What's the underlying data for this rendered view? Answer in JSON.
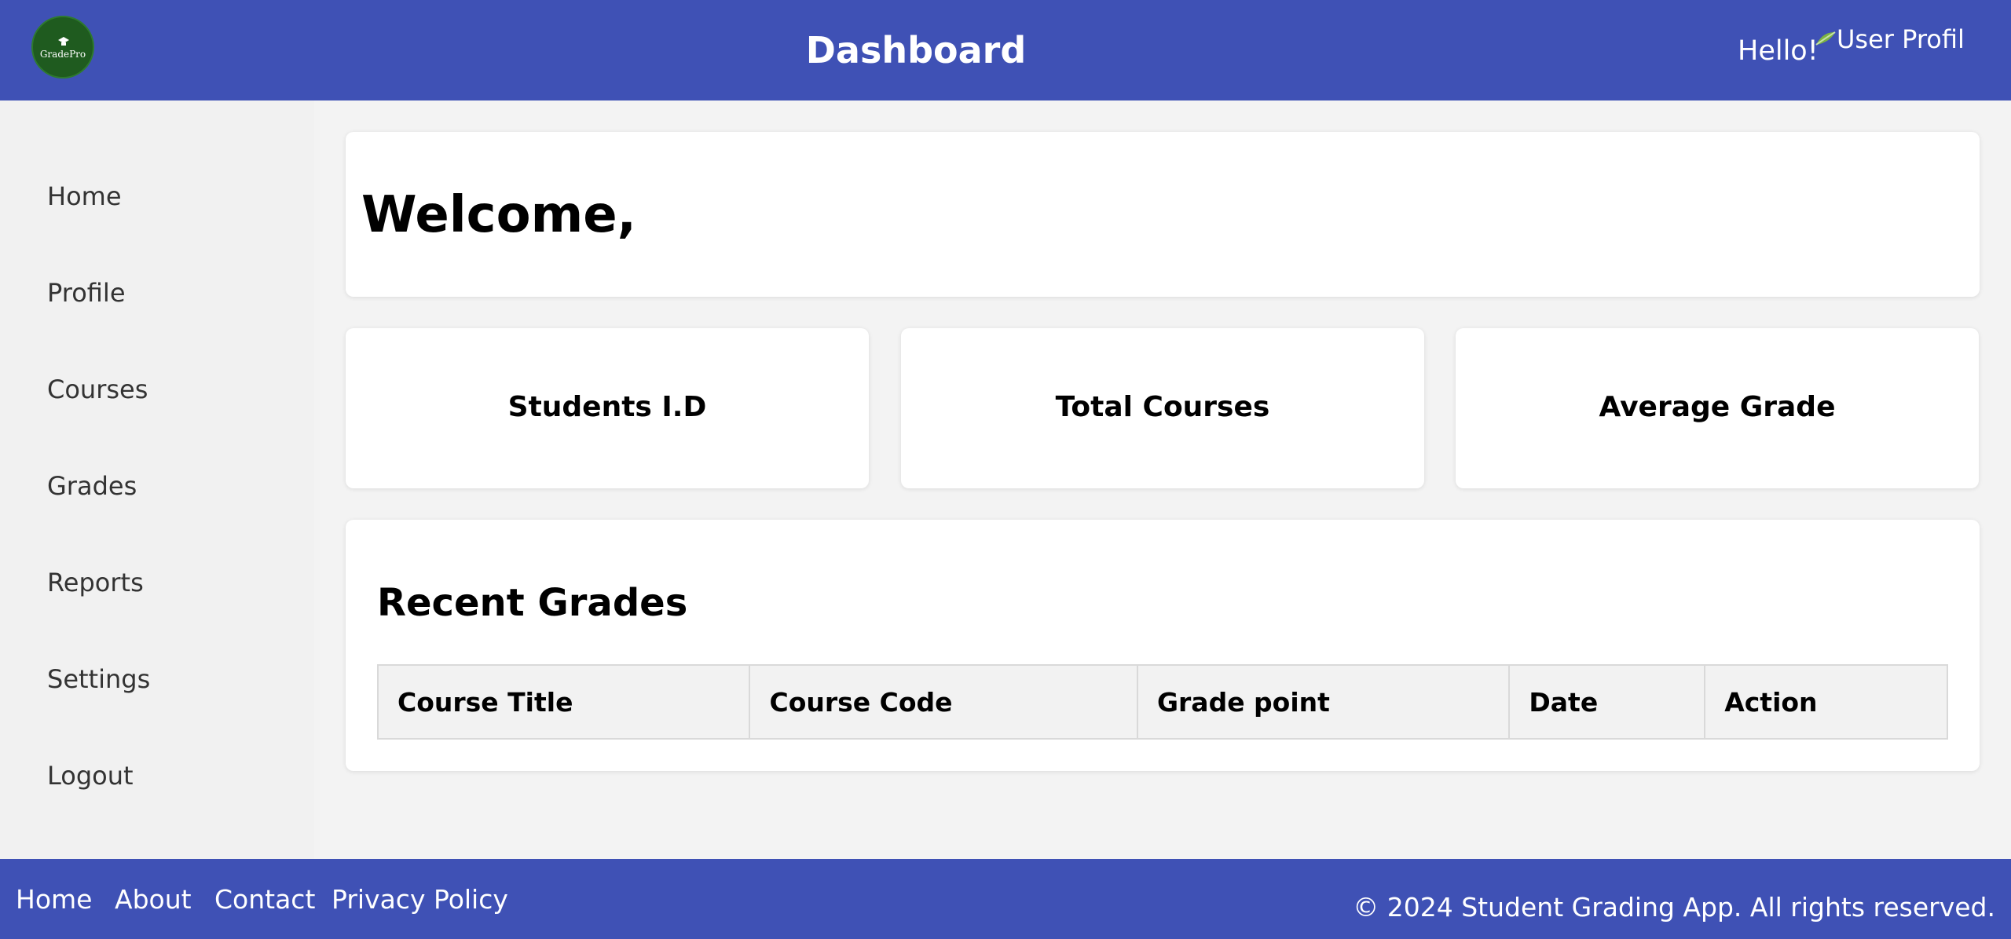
{
  "header": {
    "logo_text": "GradePro",
    "title": "Dashboard",
    "greeting": "Hello!",
    "profile_image_alt": "User Profile"
  },
  "sidebar": {
    "items": [
      {
        "label": "Home"
      },
      {
        "label": "Profile"
      },
      {
        "label": "Courses"
      },
      {
        "label": "Grades"
      },
      {
        "label": "Reports"
      },
      {
        "label": "Settings"
      },
      {
        "label": "Logout"
      }
    ]
  },
  "welcome": {
    "title": "Welcome,"
  },
  "stats": [
    {
      "label": "Students I.D"
    },
    {
      "label": "Total Courses"
    },
    {
      "label": "Average Grade"
    }
  ],
  "recent_grades": {
    "title": "Recent Grades",
    "columns": [
      "Course Title",
      "Course Code",
      "Grade point",
      "Date",
      "Action"
    ]
  },
  "footer": {
    "links": [
      {
        "label": "Home"
      },
      {
        "label": "About"
      },
      {
        "label": "Contact"
      },
      {
        "label": "Privacy Policy"
      }
    ],
    "copyright": "© 2024 Student Grading App. All rights reserved."
  },
  "colors": {
    "primary": "#3f51b5",
    "logo_green": "#1f5b1f",
    "background": "#f3f3f3",
    "sidebar": "#f1f1f1"
  }
}
